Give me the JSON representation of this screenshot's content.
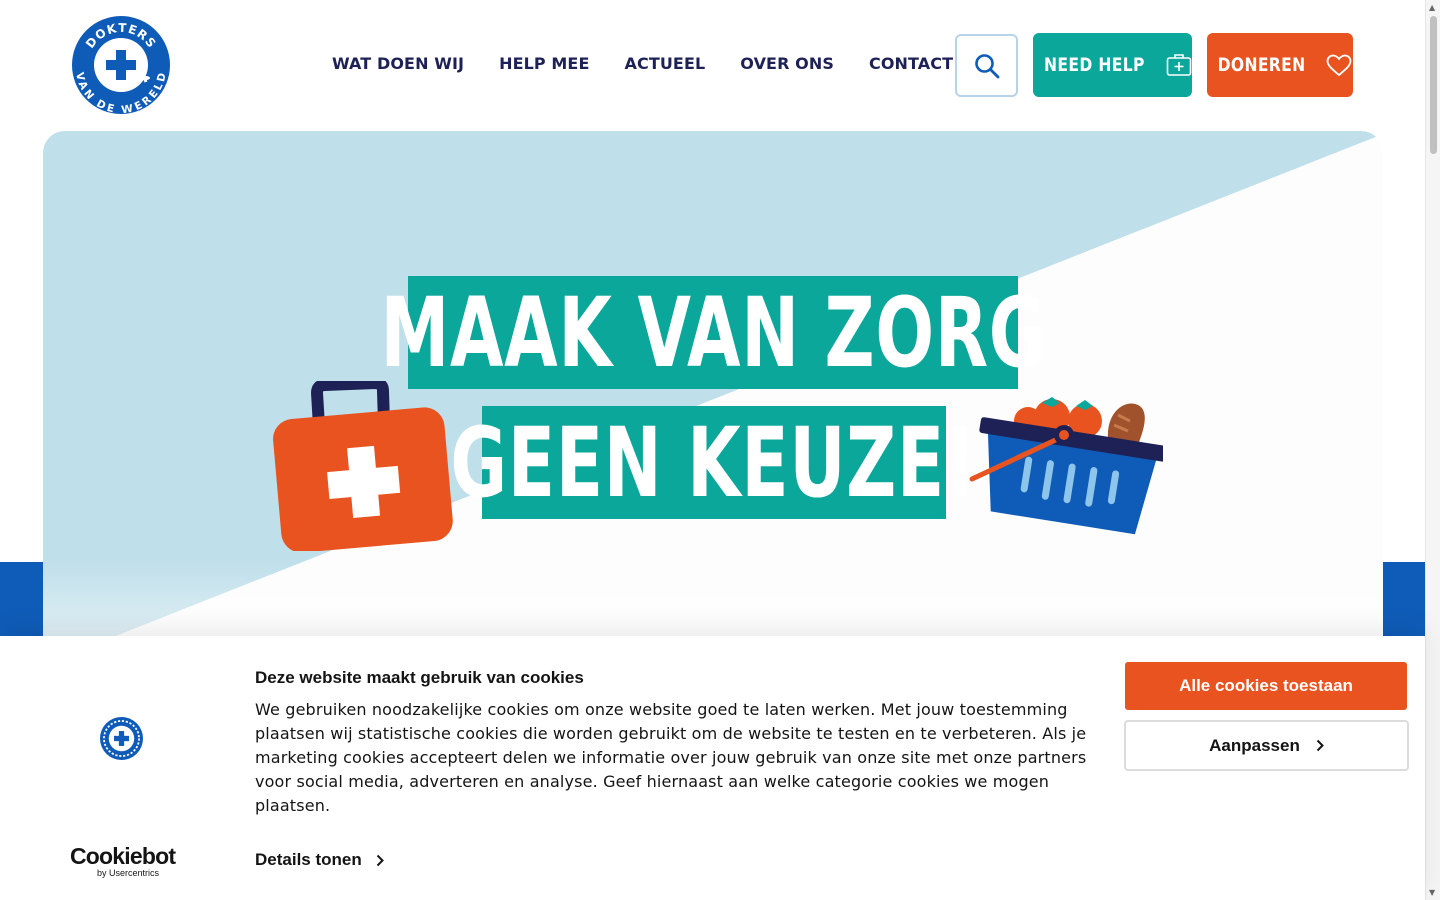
{
  "brand": {
    "name": "Dokters van de Wereld",
    "logo_text_top": "DOKTERS",
    "logo_text_bottom": "VAN DE WERELD",
    "primary_blue": "#0f5cb8",
    "teal": "#0aa79a",
    "orange": "#e8531f",
    "navy": "#1e2156"
  },
  "nav": {
    "items": [
      {
        "label": "WAT DOEN WIJ"
      },
      {
        "label": "HELP MEE"
      },
      {
        "label": "ACTUEEL"
      },
      {
        "label": "OVER ONS"
      },
      {
        "label": "CONTACT"
      }
    ]
  },
  "header_actions": {
    "search_icon": "search-icon",
    "need_help_label": "NEED HELP",
    "need_help_icon": "first-aid-kit-icon",
    "donate_label": "DONEREN",
    "donate_icon": "heart-icon"
  },
  "hero": {
    "headline_line1": "MAAK VAN ZORG",
    "headline_line2": "GEEN KEUZE!",
    "illustration_left": "first-aid-kit",
    "illustration_right": "shopping-basket-with-groceries"
  },
  "cookie_banner": {
    "title": "Deze website maakt gebruik van cookies",
    "body": "We gebruiken noodzakelijke cookies om onze website goed te laten werken. Met jouw toestemming plaatsen wij statistische cookies die worden gebruikt om de website te testen en te verbeteren. Als je marketing cookies accepteert delen we informatie over jouw gebruik van onze site met onze partners voor social media, adverteren en analyse. Geef hiernaast aan welke categorie cookies we mogen plaatsen.",
    "details_label": "Details tonen",
    "allow_all_label": "Alle cookies toestaan",
    "customize_label": "Aanpassen",
    "provider_name": "Cookiebot",
    "provider_sub": "by Usercentrics"
  }
}
